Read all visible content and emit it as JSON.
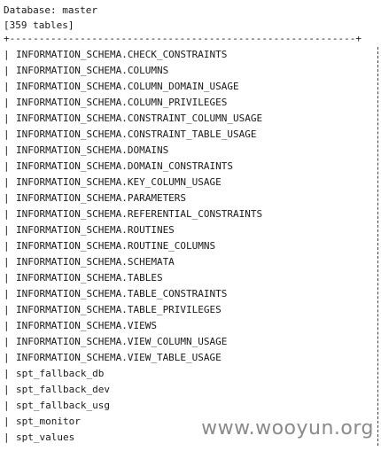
{
  "header": {
    "database_line": "Database: master",
    "count_line": "[359 tables]"
  },
  "table": {
    "border_line": "+-----------------------------------------------------------+",
    "rows": [
      "INFORMATION_SCHEMA.CHECK_CONSTRAINTS",
      "INFORMATION_SCHEMA.COLUMNS",
      "INFORMATION_SCHEMA.COLUMN_DOMAIN_USAGE",
      "INFORMATION_SCHEMA.COLUMN_PRIVILEGES",
      "INFORMATION_SCHEMA.CONSTRAINT_COLUMN_USAGE",
      "INFORMATION_SCHEMA.CONSTRAINT_TABLE_USAGE",
      "INFORMATION_SCHEMA.DOMAINS",
      "INFORMATION_SCHEMA.DOMAIN_CONSTRAINTS",
      "INFORMATION_SCHEMA.KEY_COLUMN_USAGE",
      "INFORMATION_SCHEMA.PARAMETERS",
      "INFORMATION_SCHEMA.REFERENTIAL_CONSTRAINTS",
      "INFORMATION_SCHEMA.ROUTINES",
      "INFORMATION_SCHEMA.ROUTINE_COLUMNS",
      "INFORMATION_SCHEMA.SCHEMATA",
      "INFORMATION_SCHEMA.TABLES",
      "INFORMATION_SCHEMA.TABLE_CONSTRAINTS",
      "INFORMATION_SCHEMA.TABLE_PRIVILEGES",
      "INFORMATION_SCHEMA.VIEWS",
      "INFORMATION_SCHEMA.VIEW_COLUMN_USAGE",
      "INFORMATION_SCHEMA.VIEW_TABLE_USAGE",
      "spt_fallback_db",
      "spt_fallback_dev",
      "spt_fallback_usg",
      "spt_monitor",
      "spt_values"
    ]
  },
  "watermark": "www.wooyun.org"
}
